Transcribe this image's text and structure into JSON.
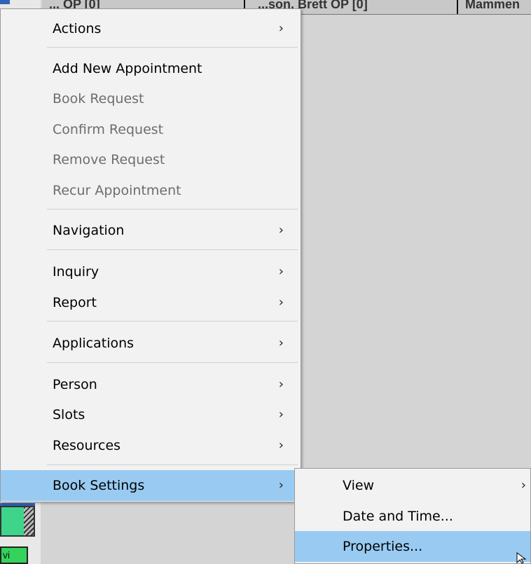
{
  "background": {
    "column_headers": [
      "... OP [0]",
      "...son, Brett OP [0]",
      "Mammen"
    ],
    "cell_fragment": "vi"
  },
  "context_menu": {
    "items": [
      {
        "label": "Actions",
        "has_submenu": true,
        "disabled": false
      },
      {
        "label": "Add New Appointment",
        "has_submenu": false,
        "disabled": false
      },
      {
        "label": "Book Request",
        "has_submenu": false,
        "disabled": true
      },
      {
        "label": "Confirm Request",
        "has_submenu": false,
        "disabled": true
      },
      {
        "label": "Remove Request",
        "has_submenu": false,
        "disabled": true
      },
      {
        "label": "Recur Appointment",
        "has_submenu": false,
        "disabled": true
      },
      {
        "label": "Navigation",
        "has_submenu": true,
        "disabled": false
      },
      {
        "label": "Inquiry",
        "has_submenu": true,
        "disabled": false
      },
      {
        "label": "Report",
        "has_submenu": true,
        "disabled": false
      },
      {
        "label": "Applications",
        "has_submenu": true,
        "disabled": false
      },
      {
        "label": "Person",
        "has_submenu": true,
        "disabled": false
      },
      {
        "label": "Slots",
        "has_submenu": true,
        "disabled": false
      },
      {
        "label": "Resources",
        "has_submenu": true,
        "disabled": false
      },
      {
        "label": "Book Settings",
        "has_submenu": true,
        "disabled": false,
        "highlighted": true
      }
    ],
    "arrow_glyph": "›"
  },
  "submenu": {
    "items": [
      {
        "label": "View",
        "has_submenu": true
      },
      {
        "label": "Date and Time..."
      },
      {
        "label": "Properties...",
        "highlighted": true
      }
    ]
  },
  "colors": {
    "highlight": "#99cbf2",
    "menu_bg": "#f2f2f2",
    "disabled_text": "#6d6d6d"
  }
}
